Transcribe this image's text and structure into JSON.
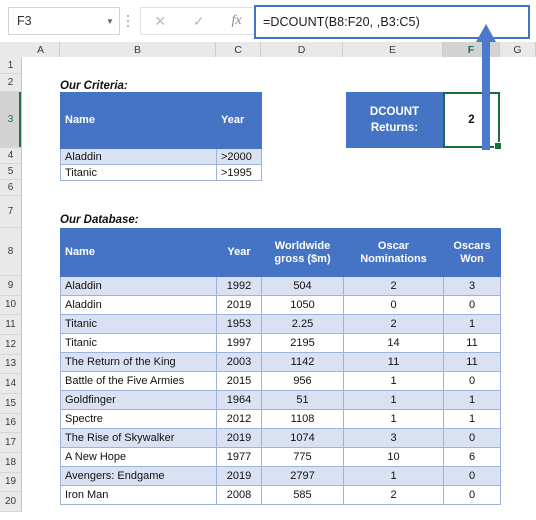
{
  "formula_bar": {
    "name_box_value": "F3",
    "formula": "=DCOUNT(B8:F20,  ,B3:C5)",
    "cancel_icon": "close-icon",
    "confirm_icon": "check-icon",
    "function_icon": "fx-icon",
    "dropdown_icon": "chevron-down-icon"
  },
  "columns": [
    {
      "label": "A",
      "selected": false
    },
    {
      "label": "B",
      "selected": false
    },
    {
      "label": "C",
      "selected": false
    },
    {
      "label": "D",
      "selected": false
    },
    {
      "label": "E",
      "selected": false
    },
    {
      "label": "F",
      "selected": true
    },
    {
      "label": "G",
      "selected": false
    }
  ],
  "rows": [
    {
      "label": "1",
      "selected": false
    },
    {
      "label": "2",
      "selected": false
    },
    {
      "label": "3",
      "selected": true
    },
    {
      "label": "4",
      "selected": false
    },
    {
      "label": "5",
      "selected": false
    },
    {
      "label": "6",
      "selected": false
    },
    {
      "label": "7",
      "selected": false
    },
    {
      "label": "8",
      "selected": false
    },
    {
      "label": "9",
      "selected": false
    },
    {
      "label": "10",
      "selected": false
    },
    {
      "label": "11",
      "selected": false
    },
    {
      "label": "12",
      "selected": false
    },
    {
      "label": "13",
      "selected": false
    },
    {
      "label": "14",
      "selected": false
    },
    {
      "label": "15",
      "selected": false
    },
    {
      "label": "16",
      "selected": false
    },
    {
      "label": "17",
      "selected": false
    },
    {
      "label": "18",
      "selected": false
    },
    {
      "label": "19",
      "selected": false
    },
    {
      "label": "20",
      "selected": false
    }
  ],
  "criteria": {
    "title": "Our Criteria:",
    "headers": [
      "Name",
      "Year"
    ],
    "rows": [
      [
        "Aladdin",
        ">2000"
      ],
      [
        "Titanic",
        ">1995"
      ]
    ]
  },
  "dcount": {
    "label_line1": "DCOUNT",
    "label_line2": "Returns:",
    "value": "2"
  },
  "database": {
    "title": "Our Database:",
    "headers": [
      "Name",
      "Year",
      "Worldwide gross ($m)",
      "Oscar Nominations",
      "Oscars Won"
    ],
    "header_lines": [
      [
        "Name"
      ],
      [
        "Year"
      ],
      [
        "Worldwide",
        "gross ($m)"
      ],
      [
        "Oscar",
        "Nominations"
      ],
      [
        "Oscars",
        "Won"
      ]
    ],
    "rows": [
      [
        "Aladdin",
        "1992",
        "504",
        "2",
        "3"
      ],
      [
        "Aladdin",
        "2019",
        "1050",
        "0",
        "0"
      ],
      [
        "Titanic",
        "1953",
        "2.25",
        "2",
        "1"
      ],
      [
        "Titanic",
        "1997",
        "2195",
        "14",
        "11"
      ],
      [
        "The Return of the King",
        "2003",
        "1142",
        "11",
        "11"
      ],
      [
        "Battle of the Five Armies",
        "2015",
        "956",
        "1",
        "0"
      ],
      [
        "Goldfinger",
        "1964",
        "51",
        "1",
        "1"
      ],
      [
        "Spectre",
        "2012",
        "1108",
        "1",
        "1"
      ],
      [
        "The Rise of Skywalker",
        "2019",
        "1074",
        "3",
        "0"
      ],
      [
        "A New Hope",
        "1977",
        "775",
        "10",
        "6"
      ],
      [
        "Avengers: Endgame",
        "2019",
        "2797",
        "1",
        "0"
      ],
      [
        "Iron Man",
        "2008",
        "585",
        "2",
        "0"
      ]
    ]
  },
  "annotation": {
    "arrow_icon": "up-arrow-annotation",
    "color": "#4a7ac8"
  },
  "theme": {
    "header_blue": "#4674c5",
    "band_blue": "#d9e1f2",
    "selection_green": "#1e6b41",
    "formula_border": "#4472c4"
  }
}
